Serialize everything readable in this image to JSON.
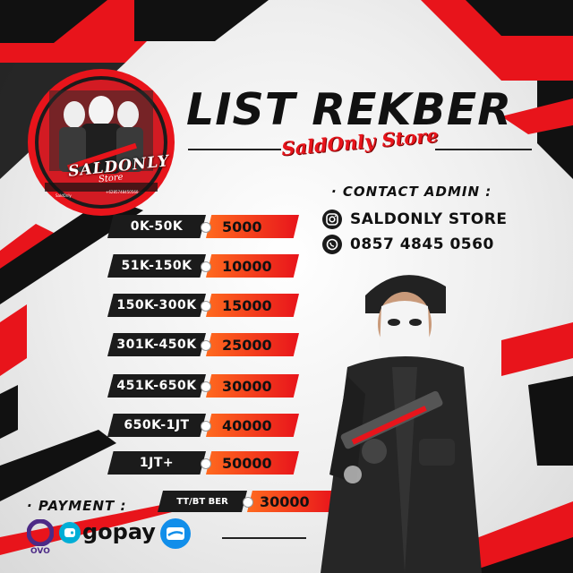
{
  "header": {
    "title": "LIST REKBER",
    "subtitle": "SaldOnly Store"
  },
  "logo": {
    "brand": "SALDONLY",
    "brand_sub": "Store",
    "handle_left": "SaldOnly",
    "handle_right": "+6285748450560"
  },
  "contact": {
    "heading": "· CONTACT ADMIN :",
    "instagram": {
      "icon": "instagram-icon",
      "text": "SALDONLY STORE"
    },
    "whatsapp": {
      "icon": "whatsapp-icon",
      "text": "0857 4845 0560"
    }
  },
  "price_list": [
    {
      "range": "0K-50K",
      "fee": "5000"
    },
    {
      "range": "51K-150K",
      "fee": "10000"
    },
    {
      "range": "150K-300K",
      "fee": "15000"
    },
    {
      "range": "301K-450K",
      "fee": "25000"
    },
    {
      "range": "451K-650K",
      "fee": "30000"
    },
    {
      "range": "650K-1JT",
      "fee": "40000"
    },
    {
      "range": "1JT+",
      "fee": "50000"
    }
  ],
  "extra_fee": {
    "range": "TT/BT BER",
    "fee": "30000"
  },
  "payment": {
    "heading": "· PAYMENT :",
    "methods": [
      {
        "name": "OVO",
        "icon": "ovo-icon"
      },
      {
        "name": "gopay",
        "icon": "gopay-icon"
      },
      {
        "name": "dana",
        "icon": "dana-icon"
      }
    ]
  },
  "colors": {
    "accent_red": "#e8141b",
    "accent_orange": "#ff6a1f",
    "dark": "#1b1b1b",
    "ovo_purple": "#4c2a86",
    "gopay_blue": "#00aed6",
    "dana_blue": "#118eea"
  }
}
